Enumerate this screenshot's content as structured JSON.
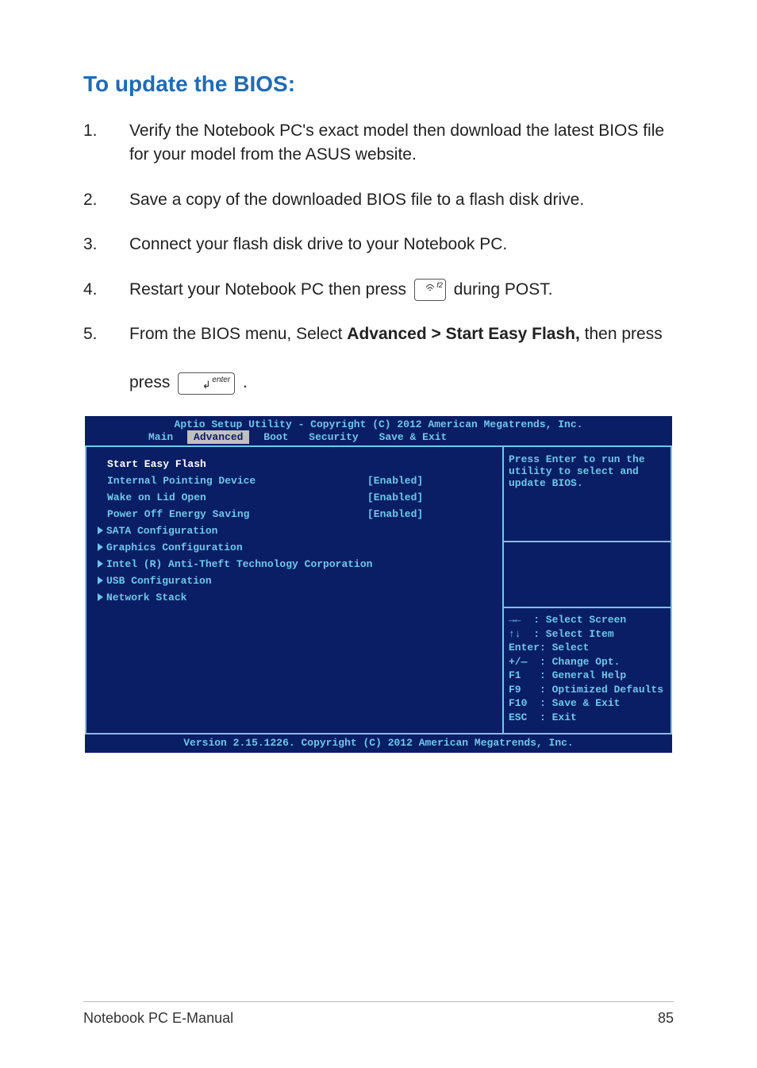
{
  "heading": "To update the BIOS:",
  "steps": [
    {
      "num": "1.",
      "body": "Verify the Notebook PC's exact model then download the latest BIOS file for your model from the ASUS website."
    },
    {
      "num": "2.",
      "body": "Save a copy of the downloaded BIOS file to a flash disk drive."
    },
    {
      "num": "3.",
      "body": "Connect your flash disk drive to your Notebook PC."
    }
  ],
  "step4": {
    "num": "4.",
    "prefix": "Restart your Notebook PC then press ",
    "key_label": "f2",
    "suffix": " during POST."
  },
  "step5": {
    "num": "5.",
    "prefix": "From the BIOS menu, Select ",
    "bold": "Advanced > Start Easy Flash,",
    "mid": " then press ",
    "key_label": "enter",
    "suffix": "."
  },
  "bios": {
    "header": "Aptio Setup Utility - Copyright (C) 2012 American Megatrends, Inc.",
    "tabs": [
      "Main",
      "Advanced",
      "Boot",
      "Security",
      "Save & Exit"
    ],
    "selected_tab": "Advanced",
    "rows": [
      {
        "label": "Start Easy Flash",
        "value": "",
        "highlight": true
      },
      {
        "label": "Internal Pointing Device",
        "value": "[Enabled]"
      },
      {
        "label": "Wake on Lid Open",
        "value": "[Enabled]"
      },
      {
        "label": "Power Off Energy Saving",
        "value": "[Enabled]"
      }
    ],
    "subs": [
      "SATA Configuration",
      "Graphics Configuration",
      "Intel (R) Anti-Theft Technology Corporation",
      "USB Configuration",
      "Network Stack"
    ],
    "help_top": "Press Enter to run the utility to select and update BIOS.",
    "help_bottom": [
      "→←  : Select Screen",
      "↑↓  : Select Item",
      "Enter: Select",
      "+/—  : Change Opt.",
      "F1   : General Help",
      "F9   : Optimized Defaults",
      "F10  : Save & Exit",
      "ESC  : Exit"
    ],
    "footer": "Version 2.15.1226. Copyright (C) 2012 American Megatrends, Inc."
  },
  "chart_data": {
    "type": "table",
    "title": "BIOS Advanced settings shown in screenshot",
    "rows": [
      {
        "setting": "Start Easy Flash",
        "value": ""
      },
      {
        "setting": "Internal Pointing Device",
        "value": "Enabled"
      },
      {
        "setting": "Wake on Lid Open",
        "value": "Enabled"
      },
      {
        "setting": "Power Off Energy Saving",
        "value": "Enabled"
      }
    ]
  },
  "footer": {
    "left": "Notebook PC E-Manual",
    "right": "85"
  }
}
